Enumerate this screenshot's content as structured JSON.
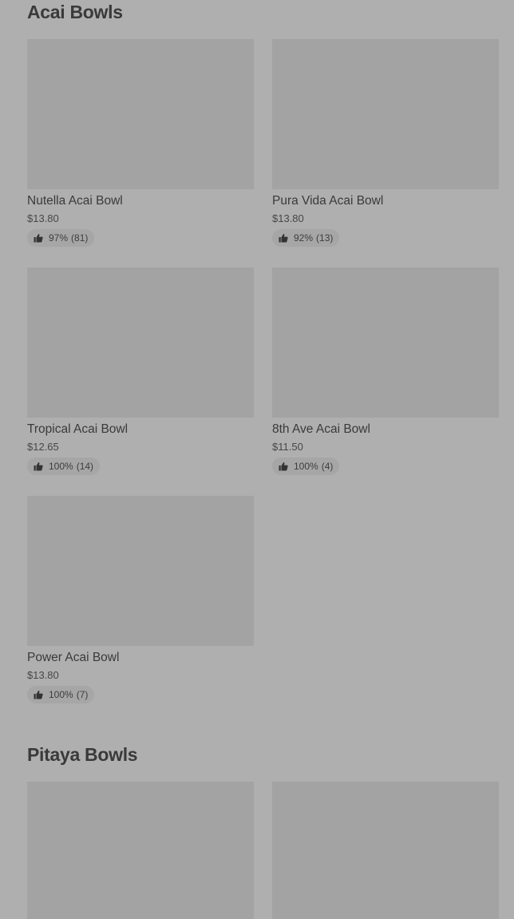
{
  "sections": [
    {
      "title": "Acai Bowls",
      "items": [
        {
          "name": "Nutella Acai Bowl",
          "price": "$13.80",
          "rating": "97%",
          "count": "(81)"
        },
        {
          "name": "Pura Vida Acai Bowl",
          "price": "$13.80",
          "rating": "92%",
          "count": "(13)"
        },
        {
          "name": "Tropical Acai Bowl",
          "price": "$12.65",
          "rating": "100%",
          "count": "(14)"
        },
        {
          "name": "8th Ave Acai Bowl",
          "price": "$11.50",
          "rating": "100%",
          "count": "(4)"
        },
        {
          "name": "Power Acai Bowl",
          "price": "$13.80",
          "rating": "100%",
          "count": "(7)"
        }
      ]
    },
    {
      "title": "Pitaya Bowls"
    }
  ],
  "icons": {
    "rating": "thumbs-up-icon"
  },
  "colors": {
    "overlay_background": "#afafaf",
    "placeholder": "#a3a3a3"
  }
}
